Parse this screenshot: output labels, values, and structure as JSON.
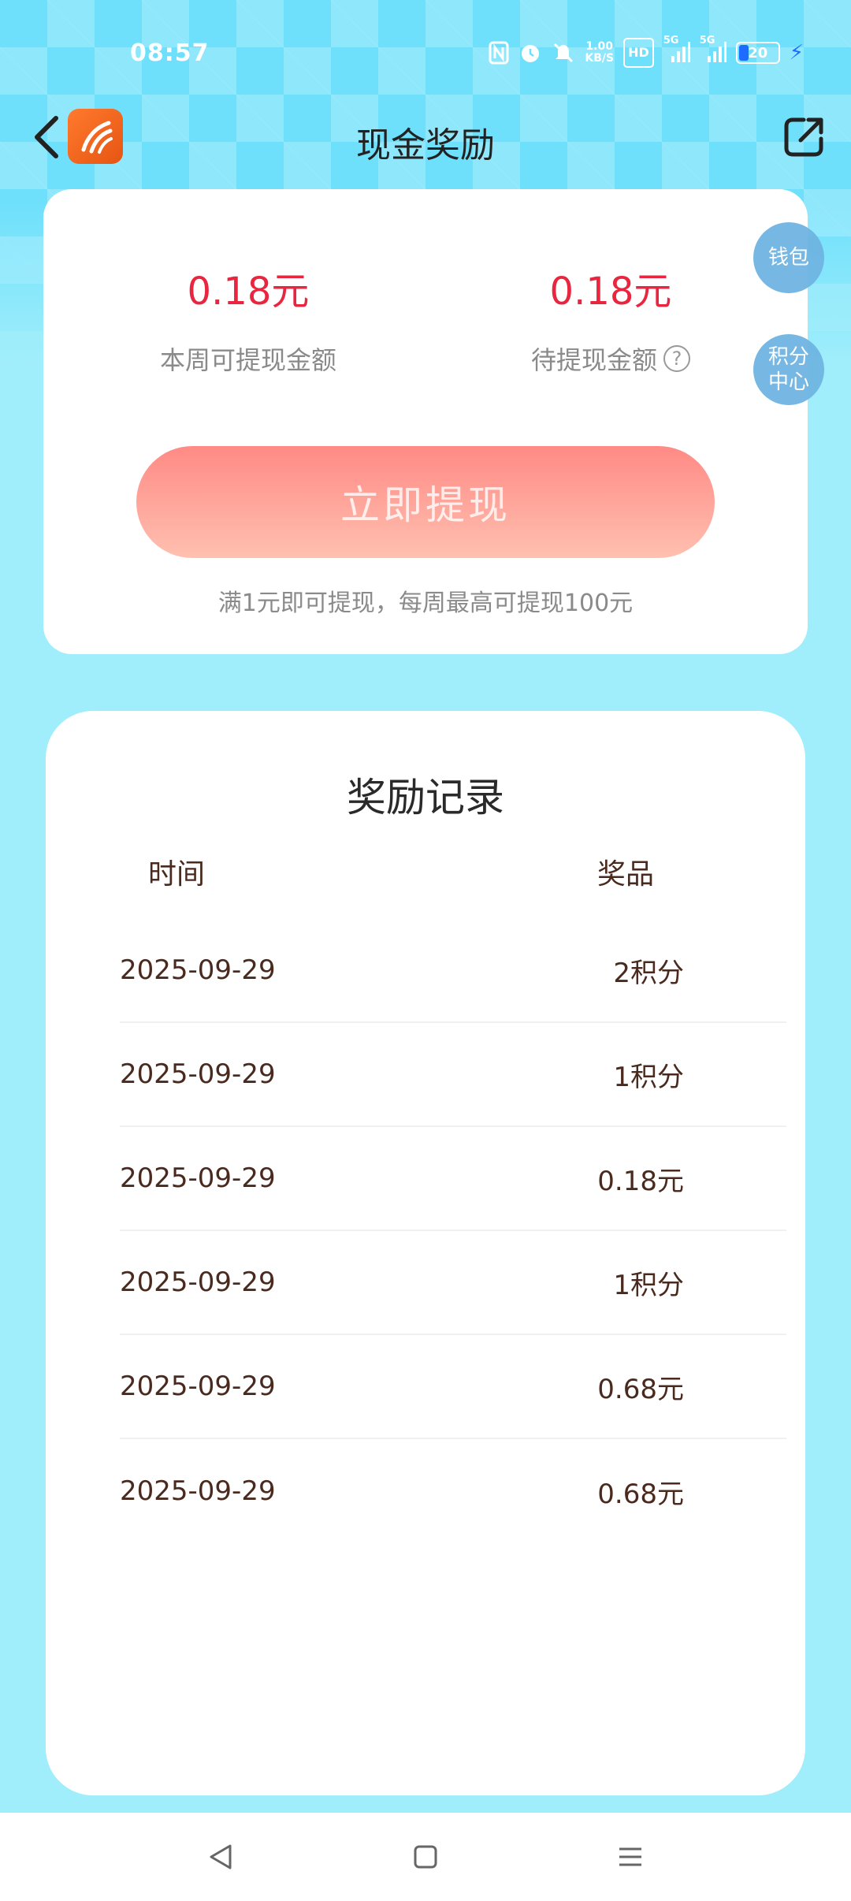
{
  "status_bar": {
    "time": "08:57",
    "net_speed_value": "1.00",
    "net_speed_unit": "KB/S",
    "hd_label": "HD",
    "signal_1": "5G",
    "signal_2": "5G",
    "battery_level": "20"
  },
  "header": {
    "title": "现金奖励"
  },
  "side_buttons": {
    "wallet": "钱包",
    "points_line1": "积分",
    "points_line2": "中心"
  },
  "cash_card": {
    "week_amount": "0.18元",
    "week_label": "本周可提现金额",
    "pending_amount": "0.18元",
    "pending_label": "待提现金额",
    "help_glyph": "?",
    "withdraw_button": "立即提现",
    "hint": "满1元即可提现，每周最高可提现100元"
  },
  "records": {
    "title": "奖励记录",
    "columns": {
      "time": "时间",
      "prize": "奖品"
    },
    "rows": [
      {
        "date": "2025-09-29",
        "prize": "2积分"
      },
      {
        "date": "2025-09-29",
        "prize": "1积分"
      },
      {
        "date": "2025-09-29",
        "prize": "0.18元"
      },
      {
        "date": "2025-09-29",
        "prize": "1积分"
      },
      {
        "date": "2025-09-29",
        "prize": "0.68元"
      },
      {
        "date": "2025-09-29",
        "prize": "0.68元"
      }
    ]
  },
  "colors": {
    "accent_red": "#e8263f",
    "background_cyan": "#a0eefb",
    "button_gradient_top": "#ff8a85",
    "button_gradient_bottom": "#ffc0b0",
    "bubble_blue": "#6fb4e2",
    "text_brown": "#4a2a1e"
  },
  "icons": {
    "back": "chevron-left-icon",
    "logo": "app-logo-icon",
    "share": "share-icon",
    "nav_back": "triangle-back-icon",
    "nav_home": "square-home-icon",
    "nav_menu": "menu-icon"
  }
}
